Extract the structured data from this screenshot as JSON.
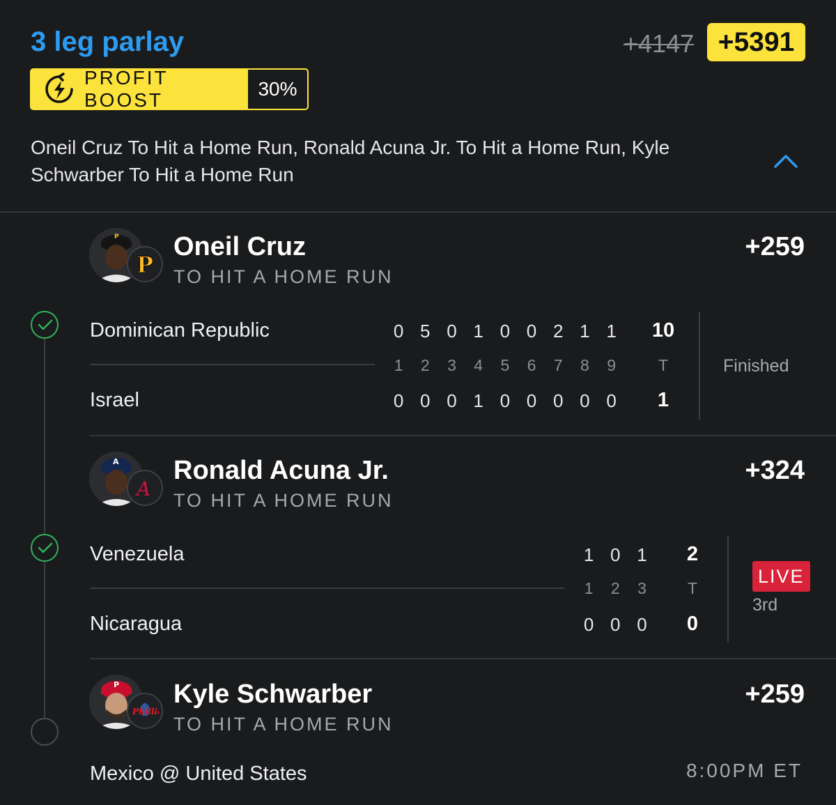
{
  "header": {
    "title": "3 leg parlay",
    "odds_original": "+4147",
    "odds_boosted": "+5391",
    "boost_label": "PROFIT BOOST",
    "boost_percent": "30%",
    "summary": "Oneil Cruz To Hit a Home Run, Ronald Acuna Jr. To Hit a Home Run, Kyle Schwarber To Hit a Home Run",
    "accent_color": "#2d9bf0",
    "boost_color": "#fbe33b"
  },
  "legs": [
    {
      "player": "Oneil Cruz",
      "market": "TO HIT A HOME RUN",
      "odds": "+259",
      "team_badge_icon": "pirates-p-logo-icon",
      "status_icon": "check-icon",
      "game": {
        "home": {
          "name": "Dominican Republic",
          "innings": [
            "0",
            "5",
            "0",
            "1",
            "0",
            "0",
            "2",
            "1",
            "1"
          ],
          "total": "10"
        },
        "away": {
          "name": "Israel",
          "innings": [
            "0",
            "0",
            "0",
            "1",
            "0",
            "0",
            "0",
            "0",
            "0"
          ],
          "total": "1"
        },
        "inning_labels": [
          "1",
          "2",
          "3",
          "4",
          "5",
          "6",
          "7",
          "8",
          "9"
        ],
        "total_label": "T",
        "status": "Finished"
      }
    },
    {
      "player": "Ronald Acuna Jr.",
      "market": "TO HIT A HOME RUN",
      "odds": "+324",
      "team_badge_icon": "braves-a-logo-icon",
      "status_icon": "check-icon",
      "game": {
        "home": {
          "name": "Venezuela",
          "innings": [
            "1",
            "0",
            "1"
          ],
          "total": "2"
        },
        "away": {
          "name": "Nicaragua",
          "innings": [
            "0",
            "0",
            "0"
          ],
          "total": "0"
        },
        "inning_labels": [
          "1",
          "2",
          "3"
        ],
        "total_label": "T",
        "live_label": "LIVE",
        "period": "3rd"
      }
    },
    {
      "player": "Kyle Schwarber",
      "market": "TO HIT A HOME RUN",
      "odds": "+259",
      "team_badge_icon": "phillies-logo-icon",
      "status_icon": "pending-circle-icon",
      "matchup": "Mexico @ United States",
      "time": "8:00PM ET"
    }
  ]
}
